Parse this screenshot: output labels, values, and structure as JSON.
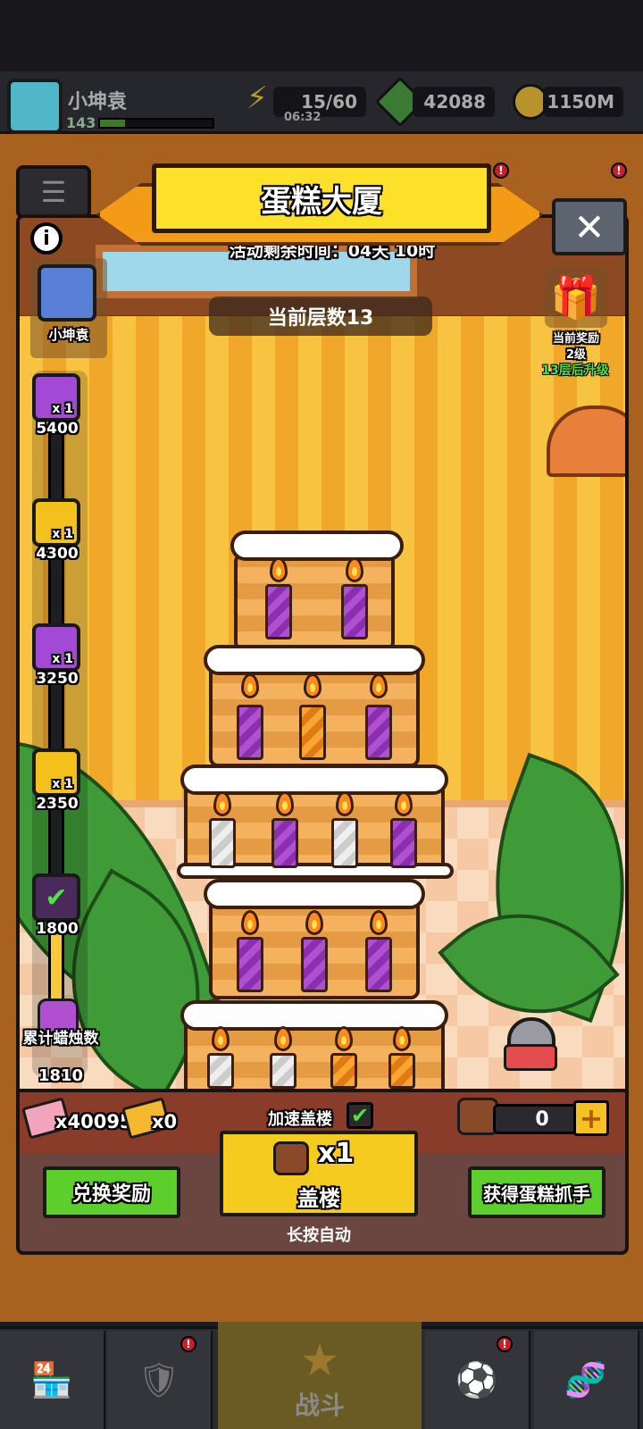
{
  "player": {
    "name": "小坤袁",
    "level": "143"
  },
  "hud": {
    "energy": "15/60",
    "energy_timer": "06:32",
    "gems": "42088",
    "coins": "1150M"
  },
  "event": {
    "title": "蛋糕大厦",
    "time_left": "活动剩余时间：04天 10时",
    "current_floor": "当前层数13",
    "player_name": "小坤袁",
    "current_reward_label": "当前奖励",
    "current_reward_level": "2级",
    "upgrade_hint": "13层后升级"
  },
  "rewards": [
    {
      "value": "5400",
      "badge": "x 1",
      "tier": "S",
      "color": "#a24ad6"
    },
    {
      "value": "4300",
      "badge": "x 1",
      "tier": "",
      "color": "#f3c01c"
    },
    {
      "value": "3250",
      "badge": "x 1",
      "tier": "S",
      "color": "#a24ad6"
    },
    {
      "value": "2350",
      "badge": "x 1",
      "tier": "",
      "color": "#f3c01c"
    },
    {
      "value": "1800",
      "badge": "x 1",
      "tier": "S",
      "color": "#4a2a5a",
      "claimed": true
    }
  ],
  "candles_total": {
    "label": "累计蜡烛数",
    "value": "1810"
  },
  "bottom": {
    "tickets_a": "x40095",
    "tickets_b": "x0",
    "speed_label": "加速盖楼",
    "speed_checked": true,
    "grabber_count": "0",
    "build_multiplier": "x1",
    "build_label": "盖楼",
    "hold_hint": "长按自动",
    "exchange_button": "兑换奖励",
    "get_grabber_button": "获得蛋糕抓手"
  },
  "nav": {
    "battle_label": "战斗"
  }
}
